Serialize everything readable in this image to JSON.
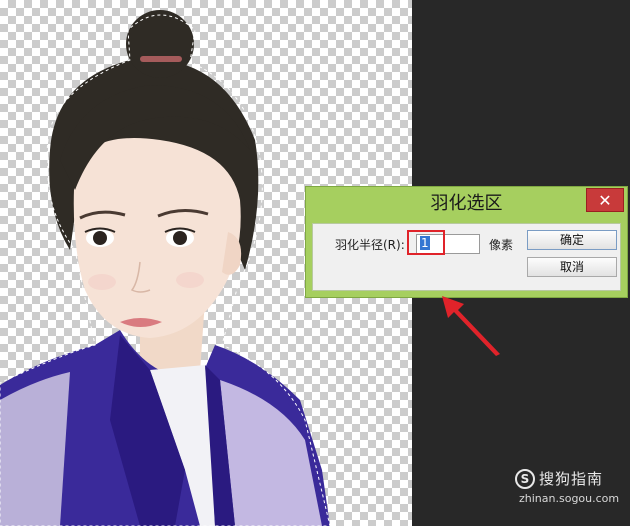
{
  "dialog": {
    "title": "羽化选区",
    "close_symbol": "✕",
    "field_label": "羽化半径(R):",
    "field_value": "1",
    "unit": "像素",
    "ok_label": "确定",
    "cancel_label": "取消"
  },
  "watermark": {
    "logo": "S",
    "text": "搜狗指南",
    "url": "zhinan.sogou.com"
  },
  "colors": {
    "dialog_frame": "#a6cf5f",
    "close_button": "#c83a3a",
    "highlight": "#e0232a",
    "robe": "#3a2a9a"
  }
}
